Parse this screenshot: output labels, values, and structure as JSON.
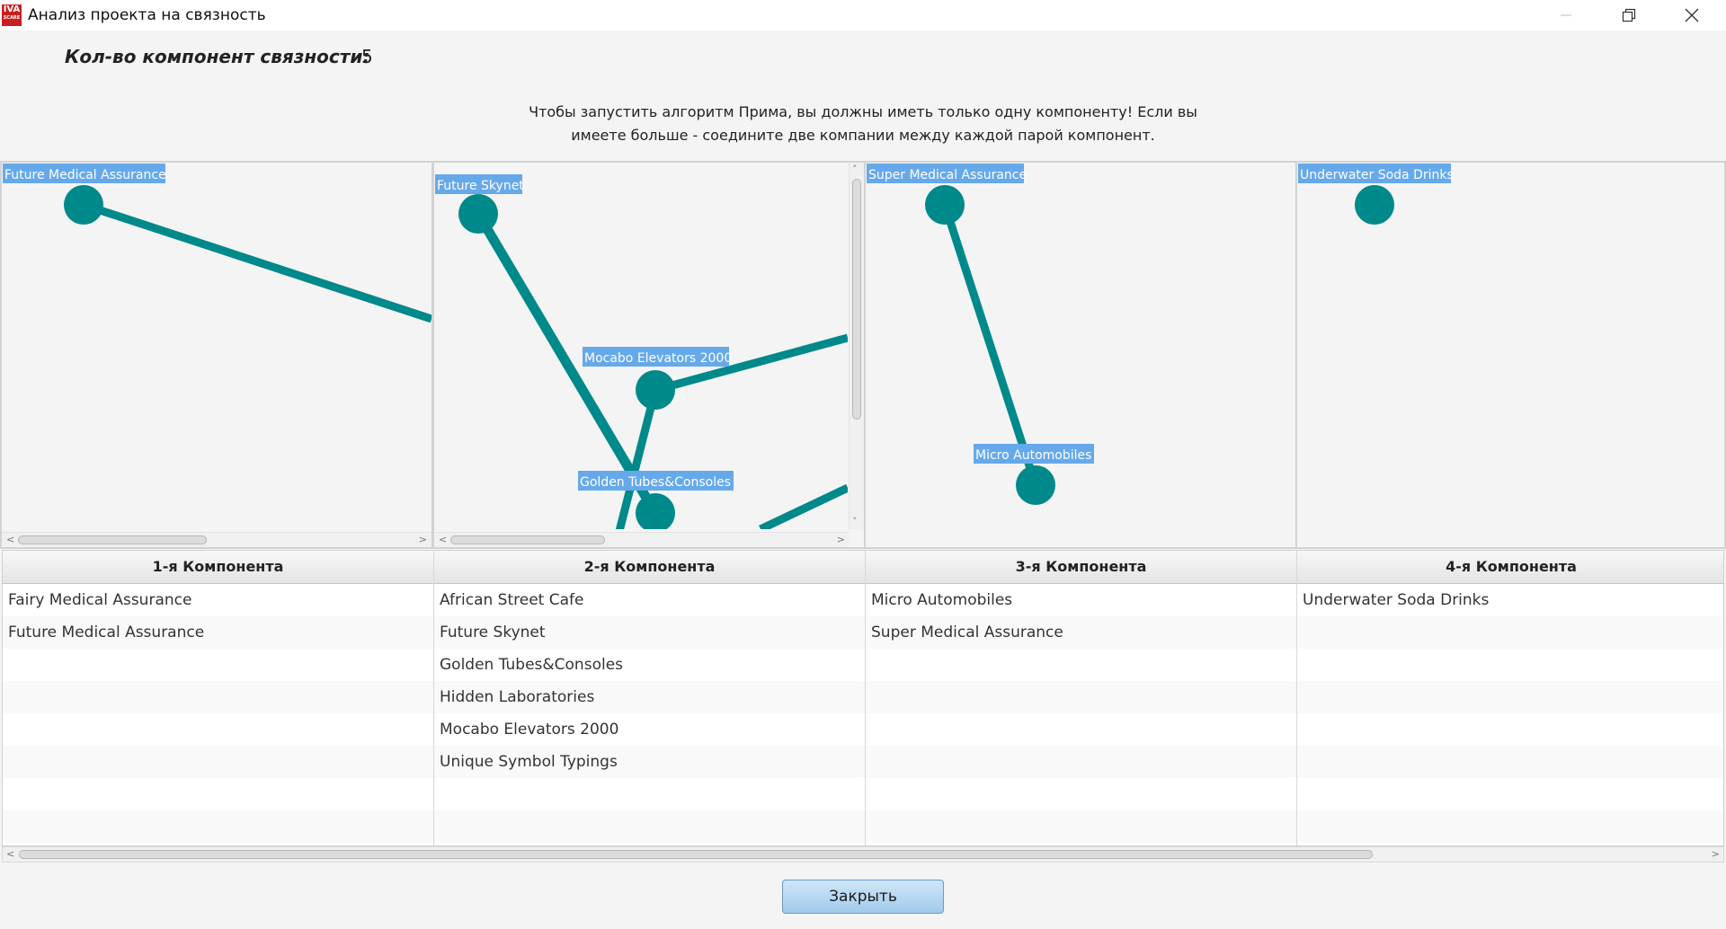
{
  "window": {
    "title": "Анализ проекта на связность",
    "logo_text": "IVA",
    "logo_subtext": "SCARE",
    "minimize_icon": "minimize-icon",
    "restore_icon": "restore-icon",
    "close_icon": "close-icon"
  },
  "summary": {
    "components_label": "Кол-во компонент связности:",
    "components_count": "5"
  },
  "instructions": "Чтобы запустить алгоритм Прима, вы должны иметь только одну компоненту! Если вы\nимеете больше - соедините две компании между каждой парой компонент.",
  "graph_colors": {
    "node": "#00898a",
    "edge": "#00898a",
    "label_background": "#66a9ea",
    "label_text": "#ffffff"
  },
  "graphs": [
    {
      "component": 1,
      "labels": [
        "Future Medical Assurance"
      ]
    },
    {
      "component": 2,
      "labels": [
        "Future Skynet",
        "Mocabo Elevators 2000",
        "Golden Tubes&Consoles"
      ]
    },
    {
      "component": 3,
      "labels": [
        "Super Medical Assurance",
        "Micro Automobiles"
      ]
    },
    {
      "component": 4,
      "labels": [
        "Underwater Soda Drinks"
      ]
    }
  ],
  "table": {
    "columns": [
      {
        "header": "1-я Компонента",
        "items": [
          "Fairy Medical Assurance",
          "Future Medical Assurance"
        ]
      },
      {
        "header": "2-я Компонента",
        "items": [
          "African Street Cafe",
          "Future Skynet",
          "Golden Tubes&Consoles",
          "Hidden Laboratories",
          "Mocabo Elevators 2000",
          "Unique Symbol Typings"
        ]
      },
      {
        "header": "3-я Компонента",
        "items": [
          "Micro Automobiles",
          "Super Medical Assurance"
        ]
      },
      {
        "header": "4-я Компонента",
        "items": [
          "Underwater Soda Drinks"
        ]
      }
    ]
  },
  "buttons": {
    "close": "Закрыть"
  }
}
